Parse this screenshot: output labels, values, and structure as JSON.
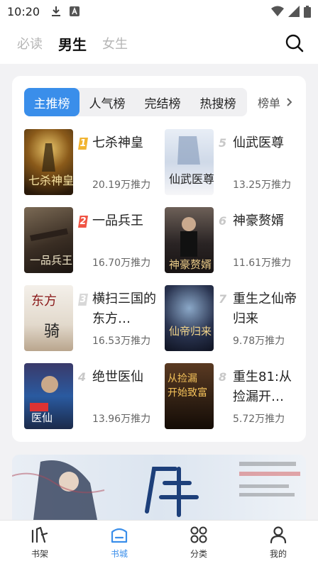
{
  "status": {
    "time": "10:20"
  },
  "top_tabs": [
    {
      "label": "必读",
      "active": false
    },
    {
      "label": "男生",
      "active": true
    },
    {
      "label": "女生",
      "active": false
    }
  ],
  "rank_tabs": [
    {
      "label": "主推榜",
      "active": true
    },
    {
      "label": "人气榜",
      "active": false
    },
    {
      "label": "完结榜",
      "active": false
    },
    {
      "label": "热搜榜",
      "active": false
    }
  ],
  "rank_more_label": "榜单",
  "books": [
    {
      "rank": "1",
      "title": "七杀神皇",
      "heat": "20.19万推力",
      "badge_color": "#f1b431"
    },
    {
      "rank": "2",
      "title": "一品兵王",
      "heat": "16.70万推力",
      "badge_color": "#f05444"
    },
    {
      "rank": "3",
      "title": "横扫三国的东方…",
      "heat": "16.53万推力",
      "badge_color": "#d8d8d8"
    },
    {
      "rank": "4",
      "title": "绝世医仙",
      "heat": "13.96万推力",
      "badge_color": ""
    },
    {
      "rank": "5",
      "title": "仙武医尊",
      "heat": "13.25万推力",
      "badge_color": ""
    },
    {
      "rank": "6",
      "title": "神豪赘婿",
      "heat": "11.61万推力",
      "badge_color": ""
    },
    {
      "rank": "7",
      "title": "重生之仙帝归来",
      "heat": "9.78万推力",
      "badge_color": ""
    },
    {
      "rank": "8",
      "title": "重生81:从捡漏开…",
      "heat": "5.72万推力",
      "badge_color": ""
    }
  ],
  "bottom_nav": [
    {
      "label": "书架",
      "icon": "bookshelf-icon",
      "active": false
    },
    {
      "label": "书城",
      "icon": "bookstore-icon",
      "active": true
    },
    {
      "label": "分类",
      "icon": "category-icon",
      "active": false
    },
    {
      "label": "我的",
      "icon": "profile-icon",
      "active": false
    }
  ],
  "colors": {
    "accent": "#3a8eea",
    "background": "#f2f2f4"
  }
}
